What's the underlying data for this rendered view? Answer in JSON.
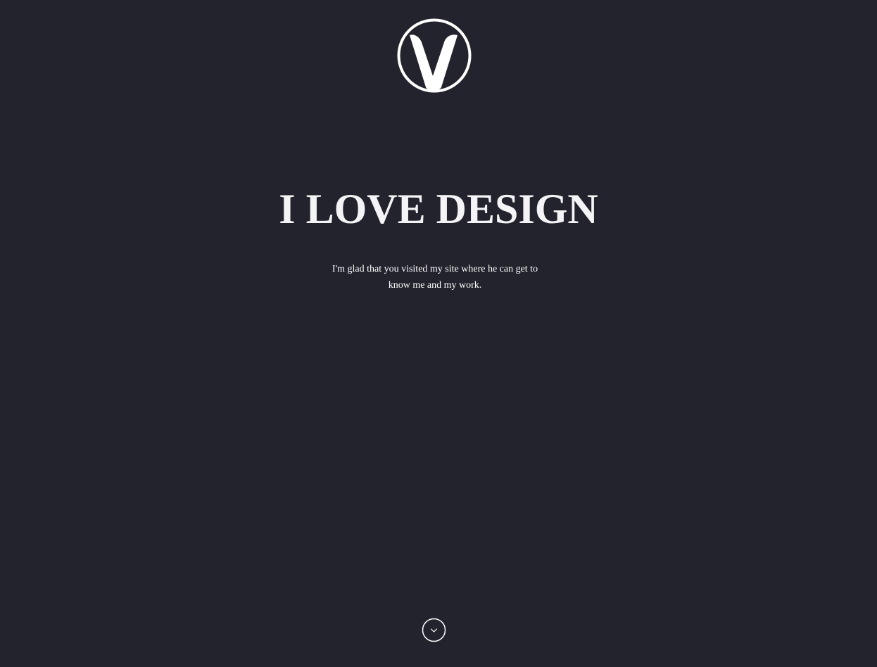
{
  "hero": {
    "logo_icon": "v-logo-icon",
    "headline": "I LOVE DESIGN",
    "intro_line1": "I'm glad that you visited my site where he can get to",
    "intro_line2": "know me and my work.",
    "scroll_icon": "chevron-down-icon"
  },
  "colors": {
    "background": "#23232d",
    "foreground": "#ffffff"
  }
}
